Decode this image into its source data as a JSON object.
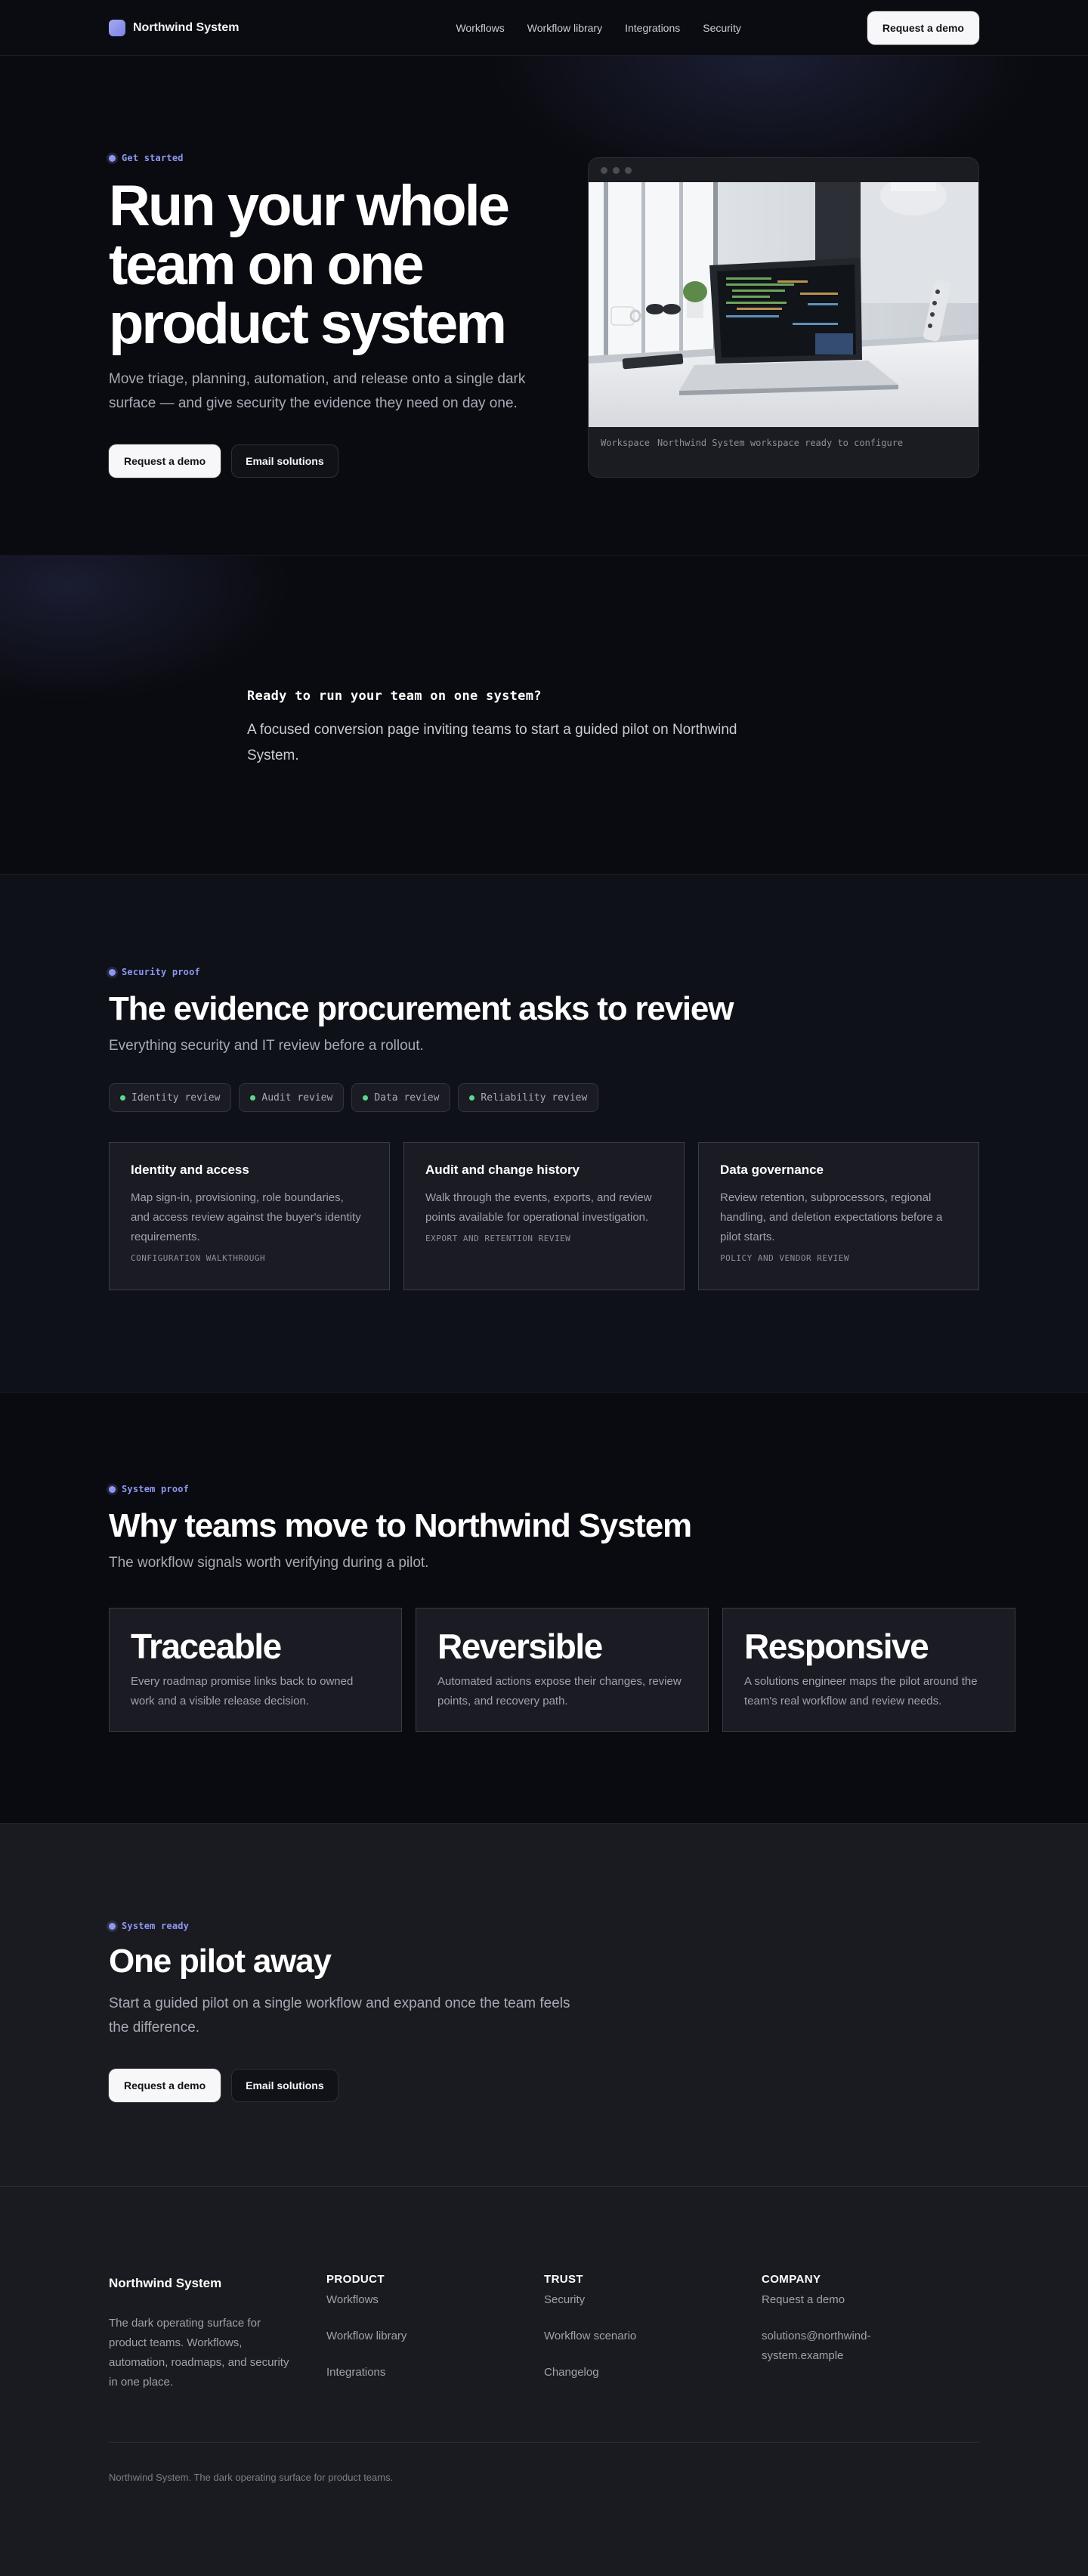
{
  "nav": {
    "brand": "Northwind System",
    "links": [
      "Workflows",
      "Workflow library",
      "Integrations",
      "Security"
    ],
    "cta": "Request a demo"
  },
  "hero": {
    "eyebrow": "Get started",
    "title_lines": [
      "Run your whole",
      "team on one",
      "product system"
    ],
    "subtitle": "Move triage, planning, automation, and release onto a single dark surface — and give security the evidence they need on day one.",
    "primary_cta": "Request a demo",
    "secondary_cta": "Email solutions",
    "window_caption_label": "Workspace",
    "window_caption_text": "Northwind System workspace ready to configure"
  },
  "ready": {
    "title": "Ready to run your team on one system?",
    "text": "A focused conversion page inviting teams to start a guided pilot on Northwind System."
  },
  "security": {
    "eyebrow": "Security proof",
    "title": "The evidence procurement asks to review",
    "subtitle": "Everything security and IT review before a rollout.",
    "chips": [
      "Identity review",
      "Audit review",
      "Data review",
      "Reliability review"
    ],
    "cards": [
      {
        "title": "Identity and access",
        "text": "Map sign-in, provisioning, role boundaries, and access review against the buyer's identity requirements.",
        "tag": "CONFIGURATION WALKTHROUGH"
      },
      {
        "title": "Audit and change history",
        "text": "Walk through the events, exports, and review points available for operational investigation.",
        "tag": "EXPORT AND RETENTION REVIEW"
      },
      {
        "title": "Data governance",
        "text": "Review retention, subprocessors, regional handling, and deletion expectations before a pilot starts.",
        "tag": "POLICY AND VENDOR REVIEW"
      }
    ]
  },
  "why": {
    "eyebrow": "System proof",
    "title": "Why teams move to Northwind System",
    "subtitle": "The workflow signals worth verifying during a pilot.",
    "cards": [
      {
        "title": "Traceable",
        "text": "Every roadmap promise links back to owned work and a visible release decision."
      },
      {
        "title": "Reversible",
        "text": "Automated actions expose their changes, review points, and recovery path."
      },
      {
        "title": "Responsive",
        "text": "A solutions engineer maps the pilot around the team's real workflow and review needs."
      }
    ]
  },
  "pilot": {
    "eyebrow": "System ready",
    "title": "One pilot away",
    "subtitle": "Start a guided pilot on a single workflow and expand once the team feels the difference.",
    "primary_cta": "Request a demo",
    "secondary_cta": "Email solutions"
  },
  "footer": {
    "brand": "Northwind System",
    "description": "The dark operating surface for product teams. Workflows, automation, roadmaps, and security in one place.",
    "columns": [
      {
        "heading": "PRODUCT",
        "links": [
          "Workflows",
          "Workflow library",
          "Integrations"
        ]
      },
      {
        "heading": "TRUST",
        "links": [
          "Security",
          "Workflow scenario",
          "Changelog"
        ]
      },
      {
        "heading": "COMPANY",
        "links": [
          "Request a demo",
          "solutions@northwind-system.example"
        ]
      }
    ],
    "copyright": "Northwind System. The dark operating surface for product teams."
  }
}
